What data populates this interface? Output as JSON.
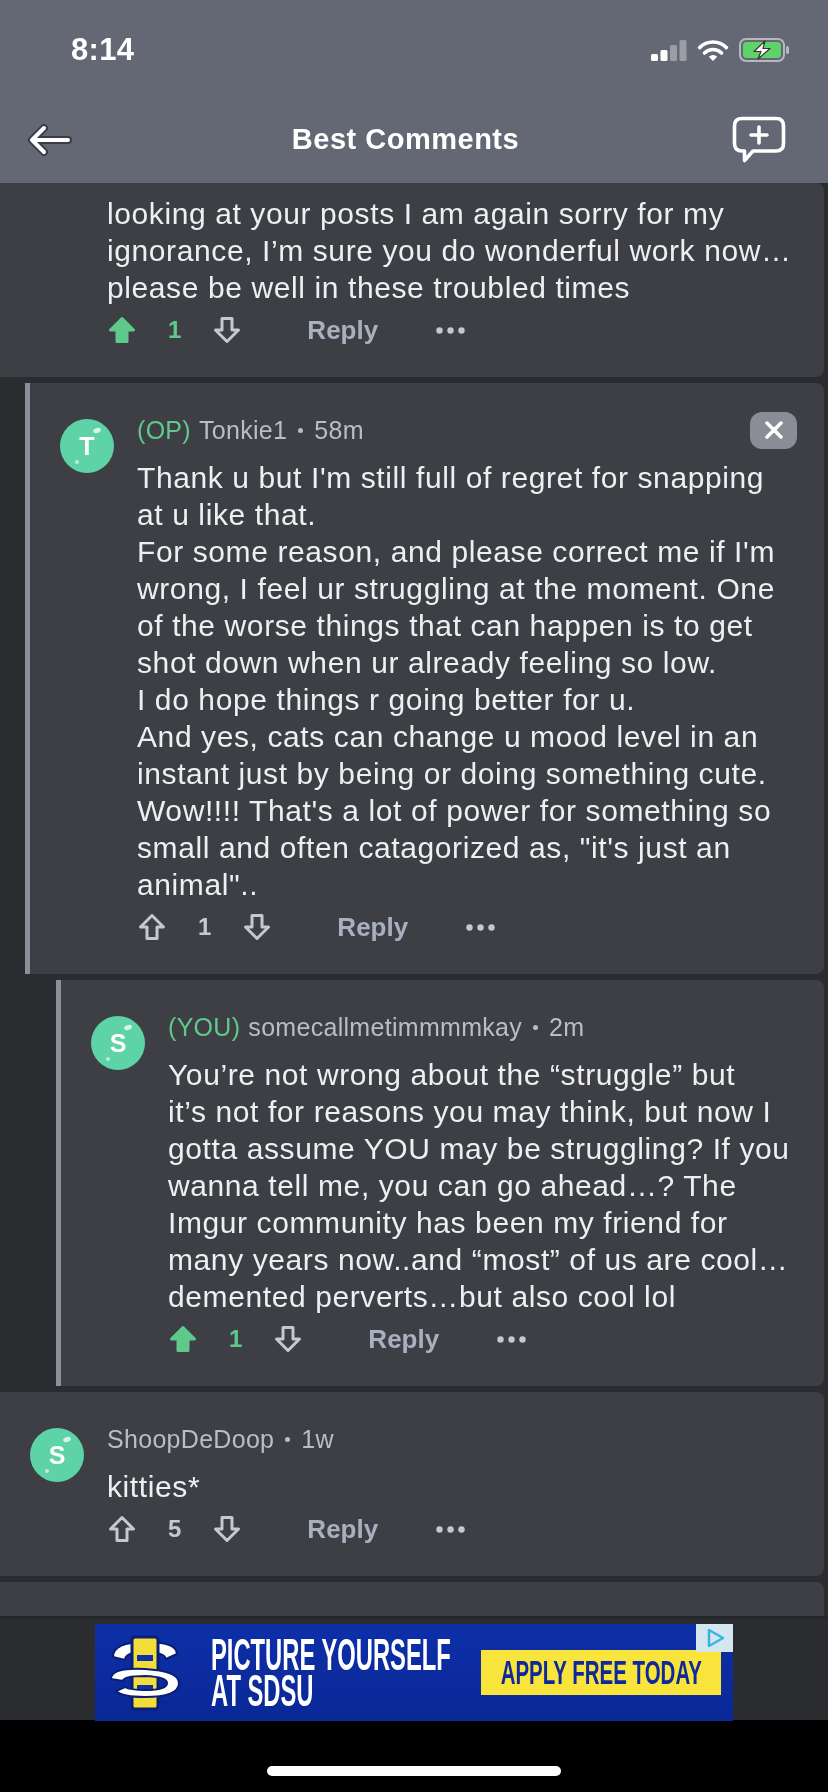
{
  "status_bar": {
    "time": "8:14"
  },
  "header": {
    "title": "Best Comments"
  },
  "comments": [
    {
      "body_lines": [
        "looking at your posts I am again sorry for my",
        "ignorance, I’m sure you do wonderful work now…",
        "please be well in these troubled times"
      ],
      "upvoted": true,
      "score": "1",
      "reply": "Reply",
      "children": [
        {
          "avatar_letter": "T",
          "badge": "(OP)",
          "author": "Tonkie1",
          "time": "58m",
          "dismissible": true,
          "body_lines": [
            "Thank u but I'm still full of regret for snapping",
            "at u like that.",
            "For some reason, and please correct me if I'm",
            "wrong, I feel ur struggling at the moment. One",
            "of the worse things that can happen is to get",
            "shot down when ur already feeling so low.",
            "I do hope things r going better for u.",
            "And yes, cats can change u mood level in an",
            "instant just by being or doing something cute.",
            "Wow!!!! That's a lot of power for something so",
            "small and often catagorized as, \"it's just an",
            "animal\".."
          ],
          "upvoted": false,
          "score": "1",
          "reply": "Reply",
          "children": [
            {
              "avatar_letter": "S",
              "badge": "(YOU)",
              "author": "somecallmetimmmmkay",
              "time": "2m",
              "dismissible": false,
              "body_lines": [
                "You’re not wrong about the “struggle” but",
                "it’s not for reasons you may think, but now I",
                "gotta assume YOU may be struggling? If you",
                "wanna tell me, you can go ahead…? The",
                "Imgur community has been my friend for",
                "many years now..and “most” of us are cool…",
                "demented perverts…but also cool lol"
              ],
              "upvoted": true,
              "score": "1",
              "reply": "Reply"
            }
          ]
        }
      ]
    },
    {
      "avatar_letter": "S",
      "author": "ShoopDeDoop",
      "time": "1w",
      "dismissible": false,
      "body_lines": [
        "kitties*"
      ],
      "upvoted": false,
      "score": "5",
      "reply": "Reply"
    }
  ],
  "ad": {
    "headline_lines": [
      "PICTURE YOURSELF",
      "AT SDSU"
    ],
    "cta": "APPLY FREE TODAY"
  }
}
